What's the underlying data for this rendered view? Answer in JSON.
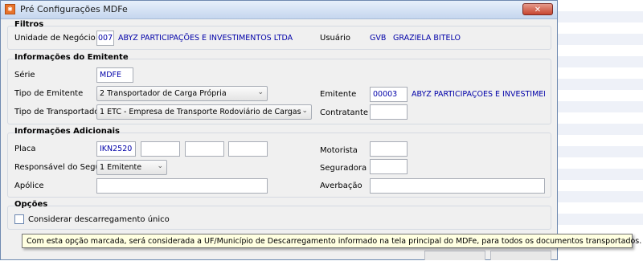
{
  "window": {
    "title": "Pré Configurações MDFe",
    "app_icon": "mdfe-app-icon",
    "close_icon": "close-icon"
  },
  "filtros": {
    "title": "Filtros",
    "unidade_label": "Unidade de Negócio",
    "unidade_code": "007",
    "unidade_name": "ABYZ PARTICIPAÇÕES E INVESTIMENTOS LTDA",
    "usuario_label": "Usuário",
    "usuario_code": "GVB",
    "usuario_name": "GRAZIELA BITELO"
  },
  "emitente": {
    "title": "Informações do Emitente",
    "serie_label": "Série",
    "serie_value": "MDFE",
    "tipo_emitente_label": "Tipo de Emitente",
    "tipo_emitente_value": "2 Transportador de Carga Própria",
    "tipo_transportador_label": "Tipo de Transportador",
    "tipo_transportador_value": "1 ETC - Empresa de Transporte Rodoviário de Cargas",
    "emitente_label": "Emitente",
    "emitente_code": "00003",
    "emitente_name": "ABYZ PARTICIPAÇÕES E INVESTIMENTOS",
    "contratante_label": "Contratante",
    "contratante_value": ""
  },
  "adicionais": {
    "title": "Informações Adicionais",
    "placa_label": "Placa",
    "placa_values": [
      "IKN2520",
      "",
      "",
      ""
    ],
    "responsavel_label": "Responsável do Seguro",
    "responsavel_value": "1 Emitente",
    "apolice_label": "Apólice",
    "apolice_value": "",
    "motorista_label": "Motorista",
    "motorista_value": "",
    "seguradora_label": "Seguradora",
    "seguradora_value": "",
    "averbacao_label": "Averbação",
    "averbacao_value": ""
  },
  "opcoes": {
    "title": "Opções",
    "descarregamento_label": "Considerar descarregamento único",
    "descarregamento_checked": false
  },
  "tooltip": "Com esta opção marcada, será considerada a UF/Município de Descarregamento informado na tela principal do MDFe, para todos os documentos transportados.",
  "colors": {
    "value_text": "#0000a8",
    "tooltip_bg": "#ffffe1",
    "close_button": "#c7452f"
  }
}
